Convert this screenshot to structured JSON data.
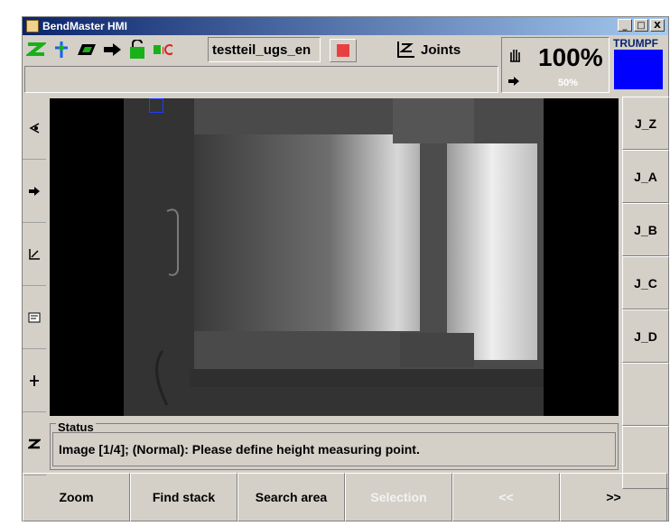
{
  "window": {
    "title": "BendMaster HMI",
    "minimize": "_",
    "maximize": "□",
    "close": "X"
  },
  "toolbar": {
    "program_name": "testteil_ugs_en",
    "joints_label": "Joints",
    "speed_percent": "100%",
    "speed_sub": "50%",
    "brand": "TRUMPF",
    "colors": {
      "stop": "#e84040",
      "brand_block": "#0000ff",
      "icon_green": "#19b019"
    }
  },
  "right_buttons": [
    "J_Z",
    "J_A",
    "J_B",
    "J_C",
    "J_D"
  ],
  "left_icons": [
    "camera-icon",
    "arrow-right-icon",
    "axis-icon",
    "panel-icon",
    "pin-icon",
    "z-icon"
  ],
  "status": {
    "legend": "Status",
    "message": "Image [1/4]; (Normal): Please define height measuring point."
  },
  "bottom_buttons": [
    {
      "label": "Zoom",
      "enabled": true
    },
    {
      "label": "Find stack",
      "enabled": true
    },
    {
      "label": "Search area",
      "enabled": true
    },
    {
      "label": "Selection",
      "enabled": false
    },
    {
      "label": "<<",
      "enabled": false
    },
    {
      "label": ">>",
      "enabled": true
    }
  ]
}
